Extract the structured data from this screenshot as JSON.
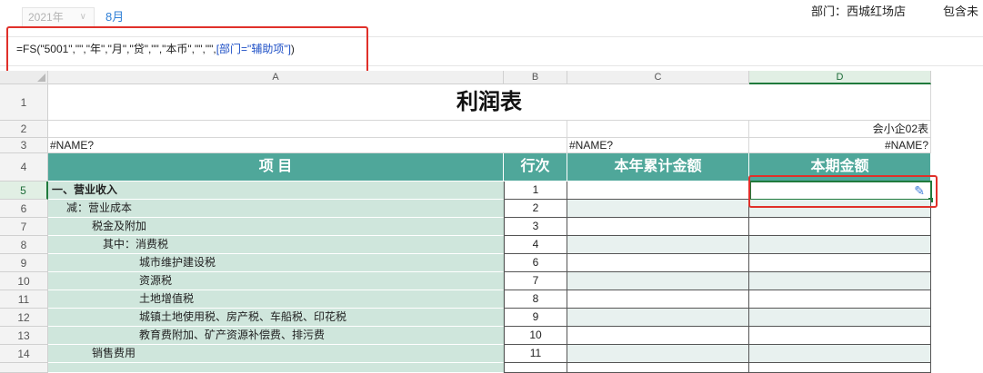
{
  "top_bar": {
    "year": "2021年",
    "month": "8月",
    "department": "部门：西城红场店",
    "include_label": "包含未"
  },
  "formula_bar": {
    "formula_main": "=FS(\"5001\",\"\",\"年\",\"月\",\"贷\",\"\",\"本币\",\"\",\"\",",
    "formula_ref": "[部门=\"辅助项\"]",
    "formula_end": ")"
  },
  "sheet": {
    "columns": [
      "A",
      "B",
      "C",
      "D"
    ],
    "title": "利润表",
    "form_code": "会小企02表",
    "name_error_a3": "#NAME?",
    "name_error_c3": "#NAME?",
    "name_error_d3": "#NAME?",
    "headers": {
      "item": "项  目",
      "line_no": "行次",
      "ytd": "本年累计金额",
      "current": "本期金额"
    },
    "rows": [
      {
        "row": "1",
        "label": ""
      },
      {
        "row": "2",
        "label": ""
      },
      {
        "row": "3",
        "label": ""
      },
      {
        "row": "4",
        "label": ""
      },
      {
        "row": "5",
        "label": "一、营业收入",
        "line": "1"
      },
      {
        "row": "6",
        "label": "减：营业成本",
        "line": "2"
      },
      {
        "row": "7",
        "label": "税金及附加",
        "line": "3"
      },
      {
        "row": "8",
        "label": "其中：消费税",
        "line": "4"
      },
      {
        "row": "9",
        "label": "城市维护建设税",
        "line": "6"
      },
      {
        "row": "10",
        "label": "资源税",
        "line": "7"
      },
      {
        "row": "11",
        "label": "土地增值税",
        "line": "8"
      },
      {
        "row": "12",
        "label": "城镇土地使用税、房产税、车船税、印花税",
        "line": "9"
      },
      {
        "row": "13",
        "label": "教育费附加、矿产资源补偿费、排污费",
        "line": "10"
      },
      {
        "row": "14",
        "label": "销售费用",
        "line": "11"
      }
    ]
  },
  "icons": {
    "year_dropdown": "chevron-down-icon",
    "edit": "pencil-icon"
  },
  "colors": {
    "header_teal": "#4fa79a",
    "item_fill": "#cfe6dc",
    "highlight_red": "#e0302a",
    "selection_green": "#1f7a3c"
  }
}
